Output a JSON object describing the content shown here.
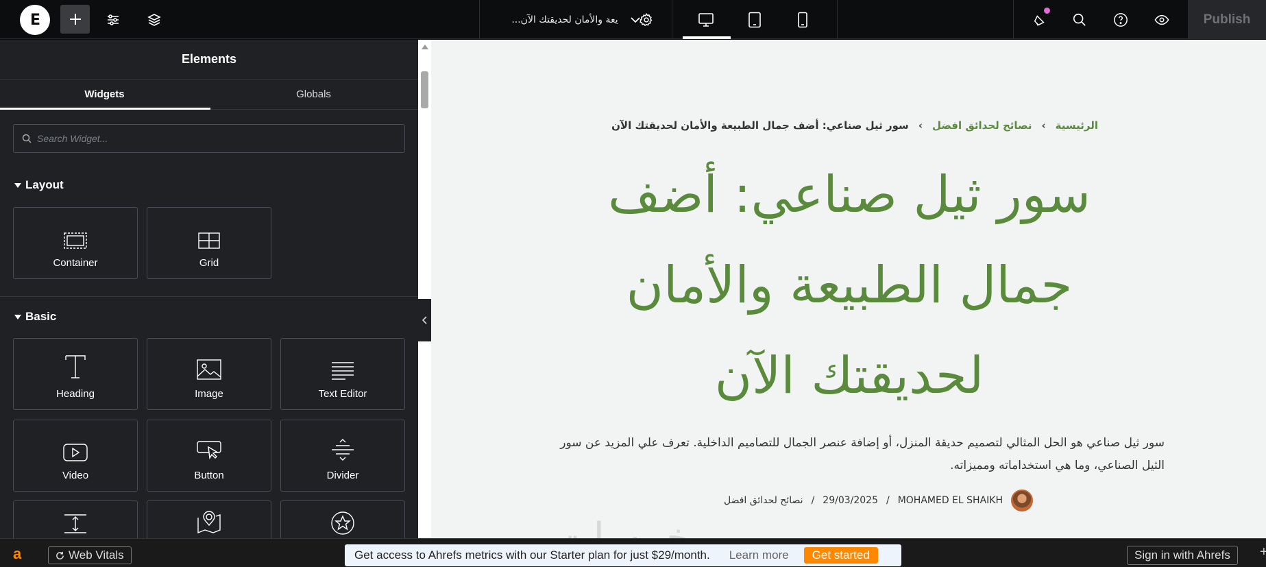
{
  "topbar": {
    "logo_glyph": "E",
    "document_title": "...يعة والأمان لحديقتك الآن",
    "publish_label": "Publish"
  },
  "panel": {
    "title": "Elements",
    "tabs": [
      {
        "label": "Widgets",
        "active": true
      },
      {
        "label": "Globals",
        "active": false
      }
    ],
    "search_placeholder": "Search Widget...",
    "layout_label": "Layout",
    "basic_label": "Basic",
    "layout_widgets": [
      {
        "label": "Container",
        "icon": "container-icon"
      },
      {
        "label": "Grid",
        "icon": "grid-icon"
      }
    ],
    "basic_widgets": [
      {
        "label": "Heading",
        "icon": "heading-icon"
      },
      {
        "label": "Image",
        "icon": "image-icon"
      },
      {
        "label": "Text Editor",
        "icon": "text-editor-icon"
      },
      {
        "label": "Video",
        "icon": "video-icon"
      },
      {
        "label": "Button",
        "icon": "button-icon"
      },
      {
        "label": "Divider",
        "icon": "divider-icon"
      }
    ]
  },
  "canvas": {
    "breadcrumb": {
      "home": "الرئيسية",
      "category": "نصائح لحدائق افضل",
      "current": "سور ثيل صناعي: أضف جمال الطبيعة والأمان لحديقتك الآن",
      "separator": "›"
    },
    "headline": "سور ثيل صناعي: أضف جمال الطبيعة والأمان لحديقتك الآن",
    "excerpt": "سور ثيل صناعي هو الحل المثالي لتصميم حديقة المنزل، أو إضافة عنصر الجمال للتصاميم الداخلية. تعرف علي المزيد عن سور الثيل الصناعي، وما هي استخداماته ومميزاته.",
    "meta": {
      "author": "MOHAMED EL SHAIKH",
      "date": "29/03/2025",
      "category": "نصائح لحدائق افضل",
      "separator": "/"
    },
    "watermark": "خمسات"
  },
  "bottombar": {
    "ahrefs_glyph": "a",
    "web_vitals_label": "Web Vitals",
    "promo_text": "Get access to Ahrefs metrics with our Starter plan for just $29/month.",
    "learn_more_label": "Learn more",
    "get_started_label": "Get started",
    "sign_in_label": "Sign in with Ahrefs",
    "plus_glyph": "+"
  },
  "colors": {
    "accent_green": "#5a8a3c",
    "panel_bg": "#1f2124",
    "ahrefs_orange": "#ff8800"
  }
}
